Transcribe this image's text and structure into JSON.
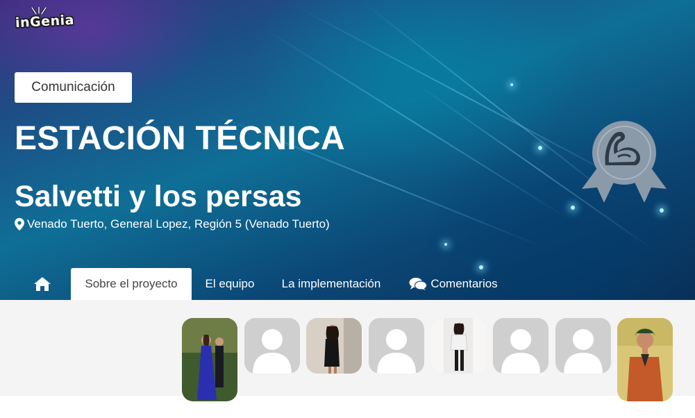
{
  "header": {
    "logo_text": "inGenia",
    "category": "Comunicación",
    "title": "ESTACIÓN TÉCNICA",
    "project_name": "Salvetti y los persas",
    "location": "Venado Tuerto, General Lopez, Región 5 (Venado Tuerto)"
  },
  "tabs": [
    {
      "label": "",
      "icon": "home-icon"
    },
    {
      "label": "Sobre el proyecto"
    },
    {
      "label": "El equipo"
    },
    {
      "label": "La implementación"
    },
    {
      "label": "Comentarios",
      "icon": "comments-icon"
    }
  ],
  "active_tab": "Sobre el proyecto",
  "team_members": [
    {
      "type": "photo"
    },
    {
      "type": "placeholder"
    },
    {
      "type": "photo"
    },
    {
      "type": "placeholder"
    },
    {
      "type": "photo"
    },
    {
      "type": "placeholder"
    },
    {
      "type": "placeholder"
    },
    {
      "type": "photo"
    }
  ],
  "colors": {
    "hero_dark": "#0a2e55",
    "hero_cyan": "#0f6f96",
    "hero_purple": "#3c2f7d",
    "content_bg": "#f4f4f4",
    "placeholder_gray": "#cfcfcf",
    "award_gray": "#8a9aa8"
  }
}
